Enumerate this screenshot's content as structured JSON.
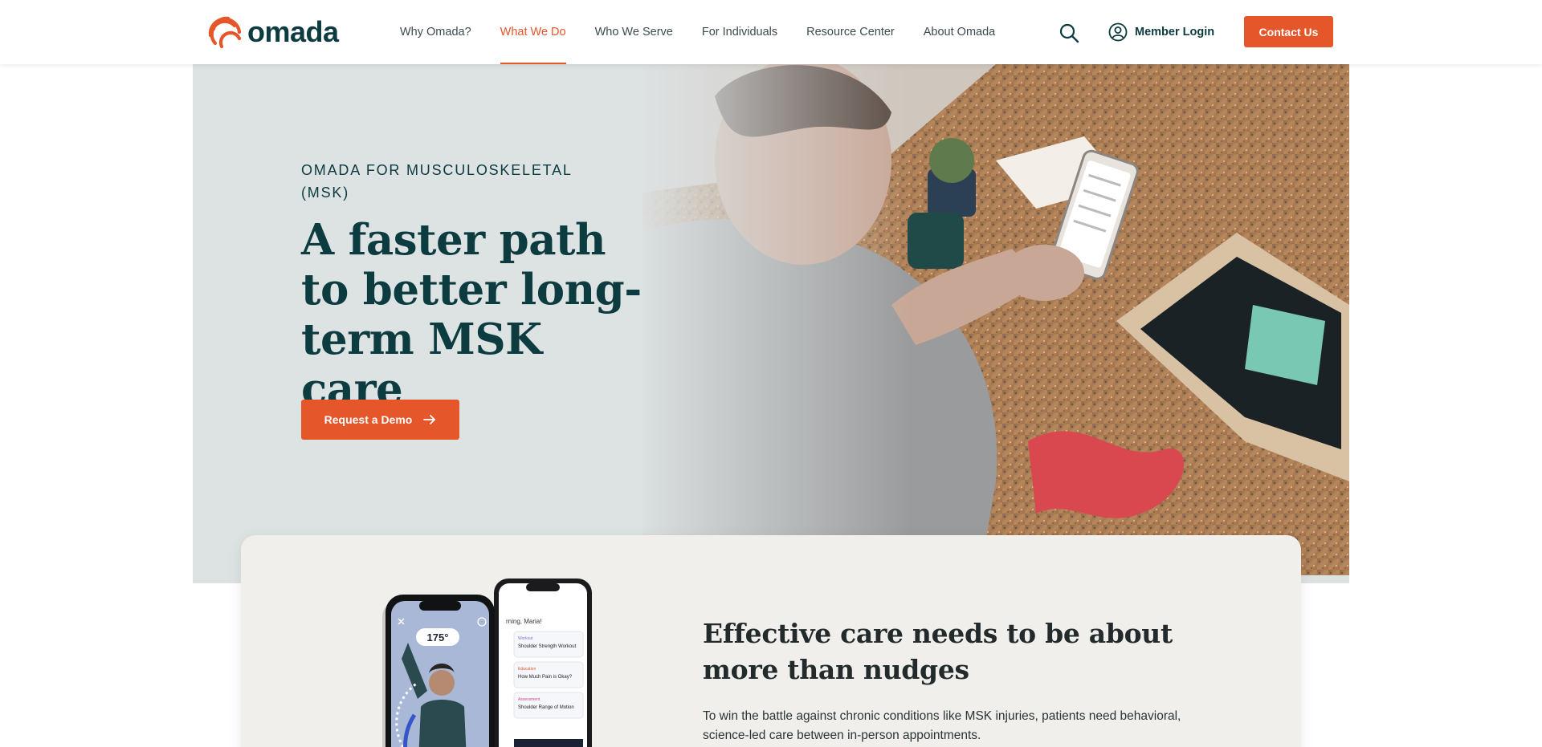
{
  "brand": {
    "name": "omada",
    "accent": "#e5572b",
    "dark": "#0c3b40"
  },
  "nav": {
    "items": [
      {
        "label": "Why Omada?"
      },
      {
        "label": "What We Do",
        "active": true
      },
      {
        "label": "Who We Serve"
      },
      {
        "label": "For Individuals"
      },
      {
        "label": "Resource Center"
      },
      {
        "label": "About Omada"
      }
    ],
    "search_icon": "search-icon",
    "member_login": "Member Login",
    "contact": "Contact Us"
  },
  "hero": {
    "eyebrow": "OMADA FOR MUSCULOSKELETAL (MSK)",
    "title": "A faster path to better long-term MSK care",
    "cta": "Request a Demo",
    "background": "#dde2e3"
  },
  "feature": {
    "title": "Effective care needs to be about more than nudges",
    "body": "To win the battle against chronic conditions like MSK injuries, patients need behavioral, science-led care between in-person appointments.",
    "phone_angle": "175°",
    "phone_greeting": "rning, Maria!",
    "phone_items": [
      {
        "tag": "Workout",
        "title": "Shoulder Strength Workout"
      },
      {
        "tag": "Education",
        "title": "How Much Pain is Okay?"
      },
      {
        "tag": "Assessment",
        "title": "Shoulder Range of Motion"
      }
    ]
  }
}
